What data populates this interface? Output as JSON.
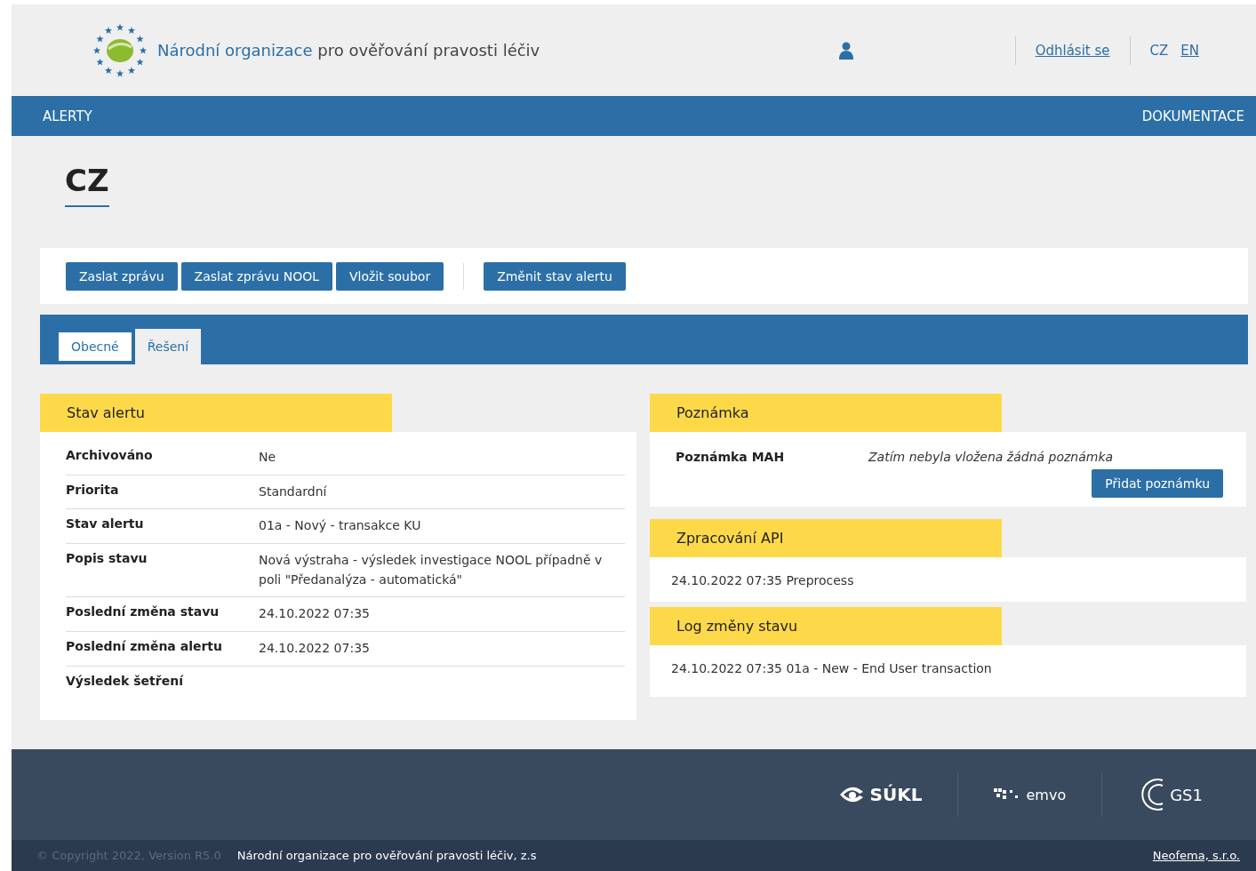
{
  "header": {
    "org_name_highlight": "Národní organizace",
    "org_name_rest": "pro ověřování pravosti léčiv",
    "logout": "Odhlásit se",
    "languages": [
      {
        "label": "CZ",
        "selected": true
      },
      {
        "label": "EN",
        "selected": false
      }
    ]
  },
  "nav": {
    "left": "ALERTY",
    "right": "DOKUMENTACE"
  },
  "title": "CZ",
  "actions": [
    {
      "label": "Zaslat zprávu",
      "separator_before": false
    },
    {
      "label": "Zaslat zprávu NOOL",
      "separator_before": false
    },
    {
      "label": "Vložit soubor",
      "separator_before": false
    },
    {
      "label": "Změnit stav alertu",
      "separator_before": true
    }
  ],
  "tabs": [
    {
      "label": "Obecné",
      "selected": false
    },
    {
      "label": "Řešení",
      "selected": true
    }
  ],
  "left_section": {
    "title": "Stav alertu",
    "rows": [
      {
        "label": "Archivováno",
        "value": "Ne"
      },
      {
        "label": "Priorita",
        "value": "Standardní"
      },
      {
        "label": "Stav alertu",
        "value": "01a - Nový - transakce KU"
      },
      {
        "label": "Popis stavu",
        "value": "Nová výstraha - výsledek investigace NOOL případně v poli \"Předanalýza - automatická\""
      },
      {
        "label": "Poslední změna stavu",
        "value": "24.10.2022 07:35"
      },
      {
        "label": "Poslední změna alertu",
        "value": "24.10.2022 07:35"
      },
      {
        "label": "Výsledek šetření"
      }
    ]
  },
  "note_section": {
    "title": "Poznámka",
    "label": "Poznámka MAH",
    "value": "Zatím nebyla vložena žádná poznámka",
    "button": "Přidat poznámku"
  },
  "api_section": {
    "title": "Zpracování API",
    "entries": [
      "24.10.2022 07:35 Preprocess"
    ]
  },
  "log_section": {
    "title": "Log změny stavu",
    "entries": [
      "24.10.2022 07:35 01a - New - End User transaction"
    ]
  },
  "footer": {
    "sukl": "SÚKL",
    "emvo": "emvo",
    "gs1": "GS1",
    "copyright": "© Copyright 2022, Version R5.0",
    "org": "Národní organizace pro ověřování pravosti léčiv, z.s",
    "vendor": "Neofema, s.r.o."
  }
}
